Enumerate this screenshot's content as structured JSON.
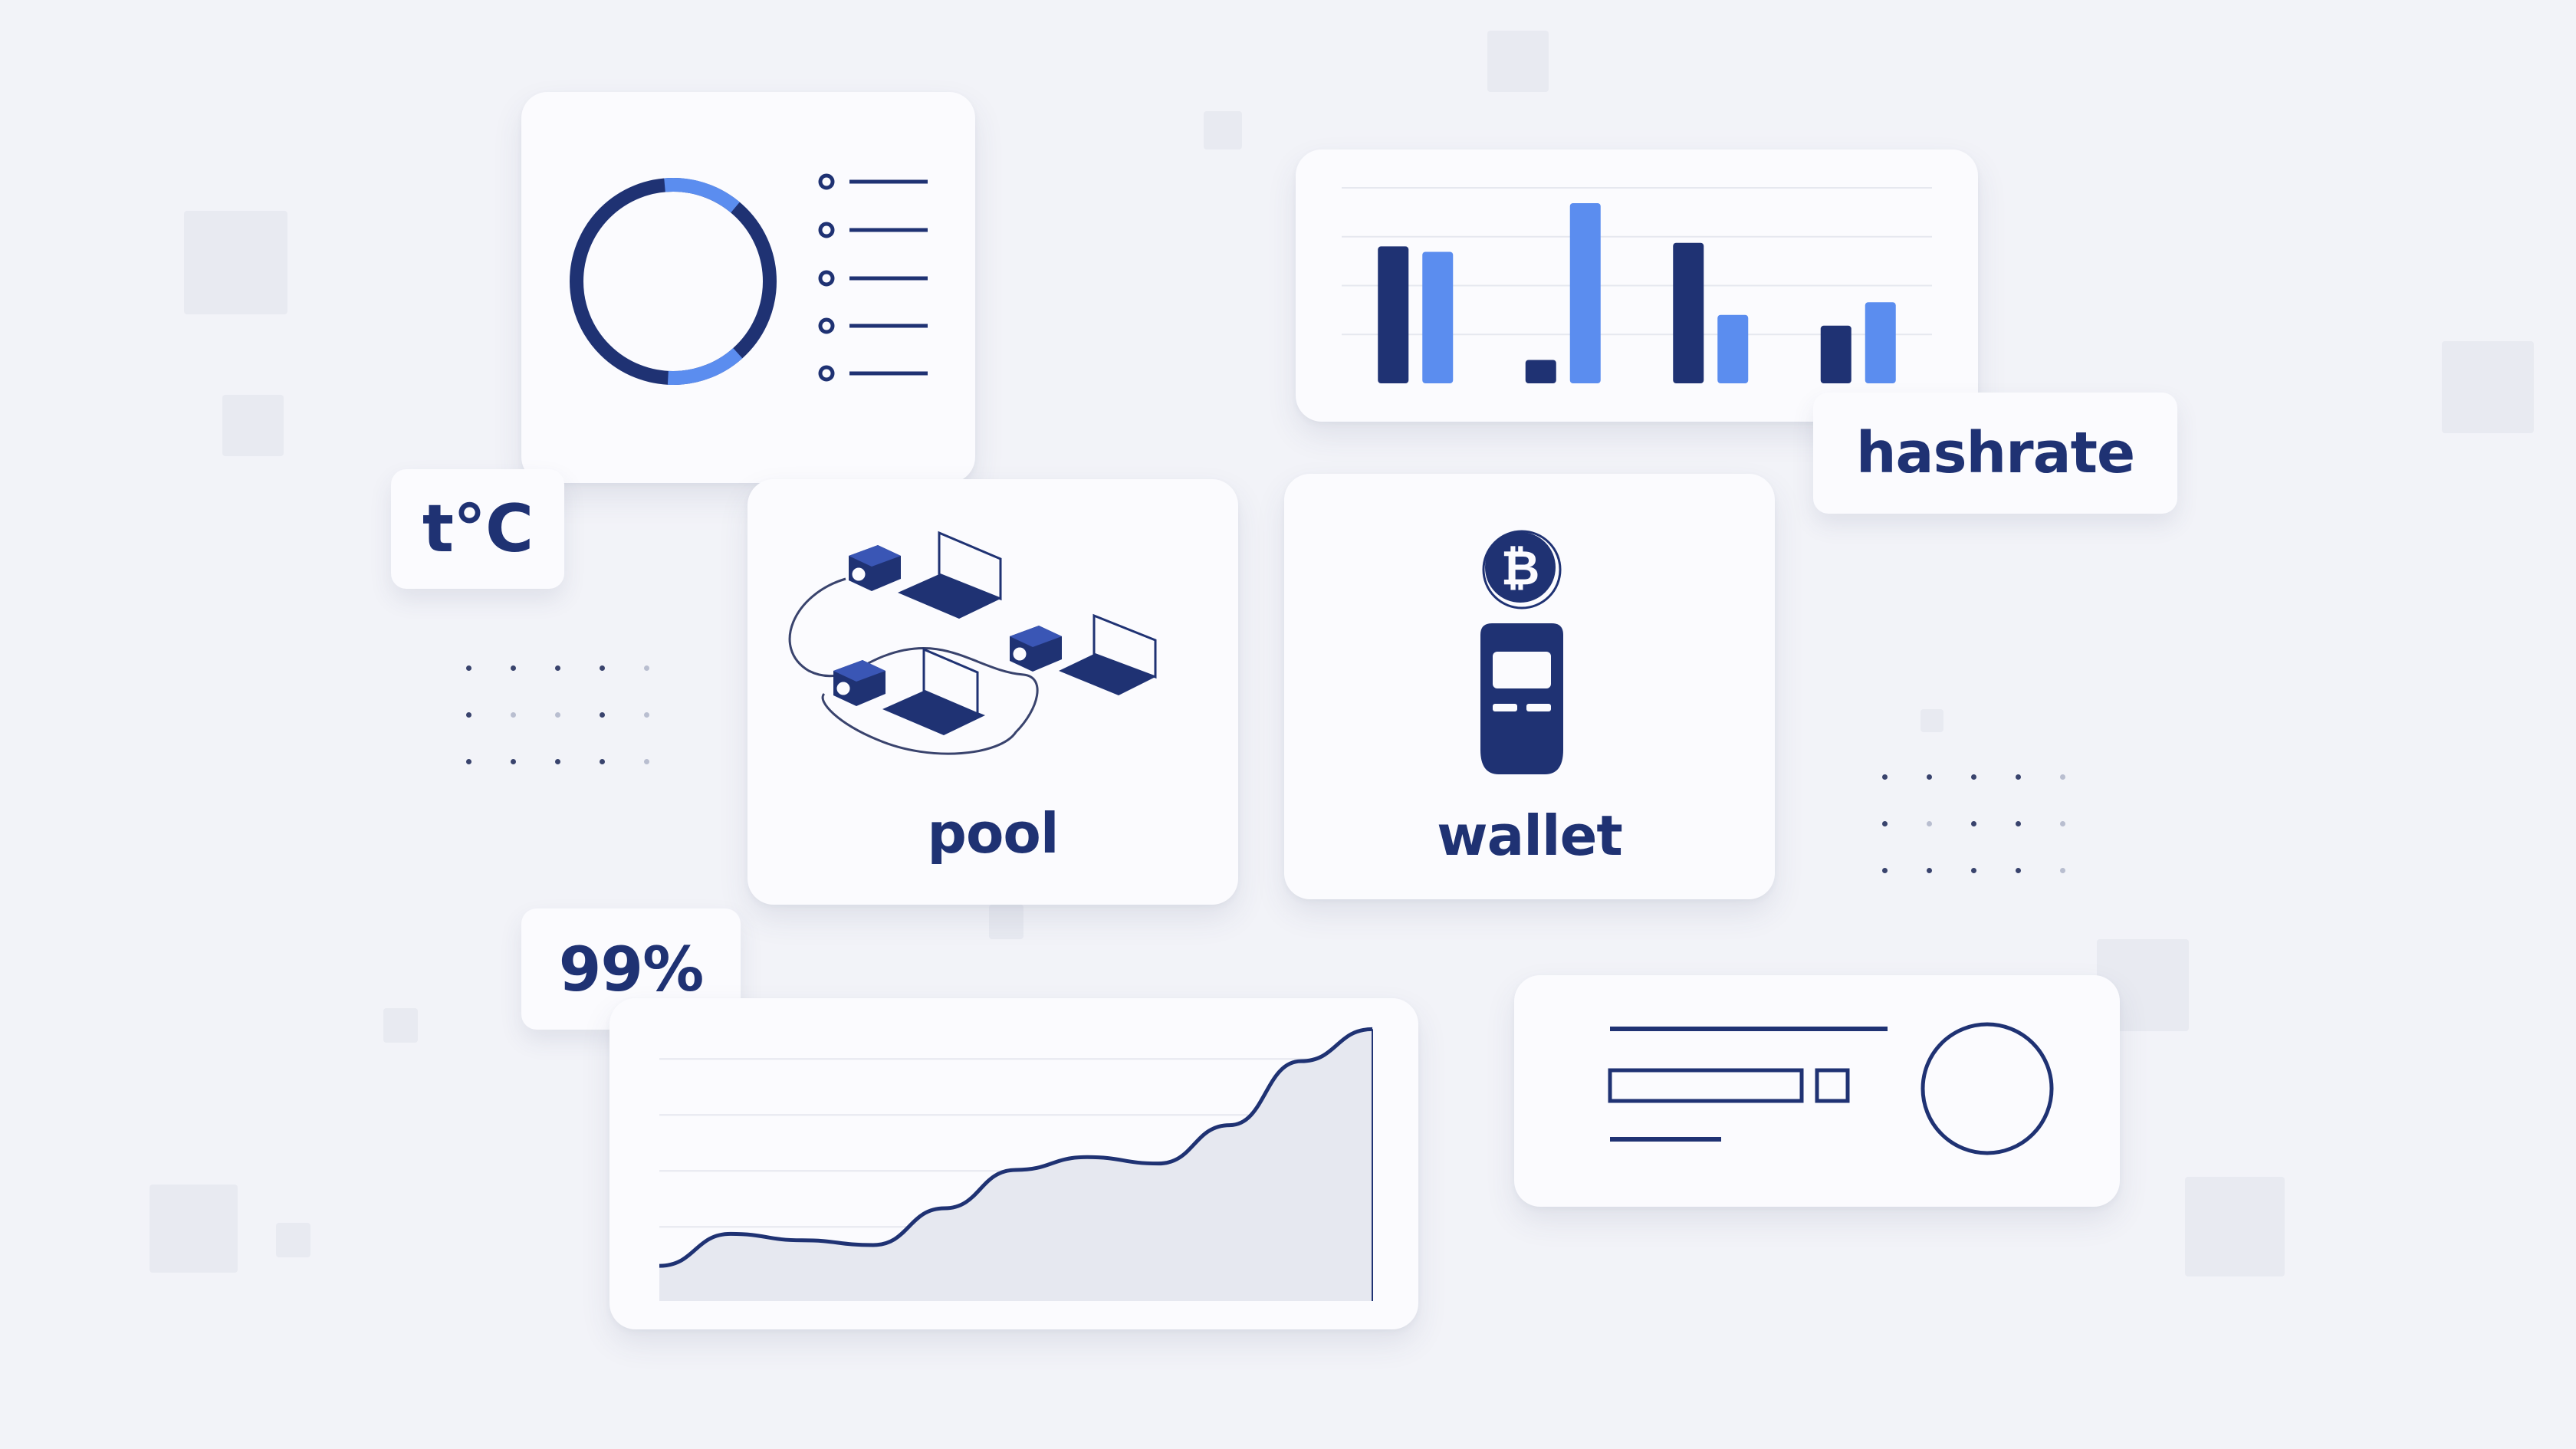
{
  "labels": {
    "temperature": "t°C",
    "hashrate": "hashrate",
    "pool": "pool",
    "wallet": "wallet",
    "uptime": "99%"
  },
  "icons": {
    "coin": "bitcoin-coin-icon",
    "wallet_device": "hardware-wallet-icon",
    "pool_network": "mining-pool-network-icon"
  },
  "colors": {
    "navy": "#1f3273",
    "blue": "#5b8def",
    "card": "#fbfbfe",
    "background": "#f2f3f8"
  },
  "donut": {
    "highlight_fraction": 0.25,
    "legend_items": 5
  },
  "chart_data": [
    {
      "type": "bar",
      "categories": [
        "",
        "",
        "",
        ""
      ],
      "series": [
        {
          "values": [
            76,
            13,
            78,
            32
          ]
        },
        {
          "values": [
            73,
            100,
            38,
            45
          ]
        }
      ],
      "ylim": [
        0,
        100
      ],
      "grid": true
    },
    {
      "type": "area",
      "x": [
        0,
        1,
        2,
        3,
        4,
        5,
        6,
        7,
        8,
        9,
        10
      ],
      "y": [
        22,
        42,
        38,
        35,
        58,
        82,
        90,
        86,
        110,
        150,
        170
      ],
      "ylim": [
        0,
        175
      ],
      "grid": true
    }
  ]
}
